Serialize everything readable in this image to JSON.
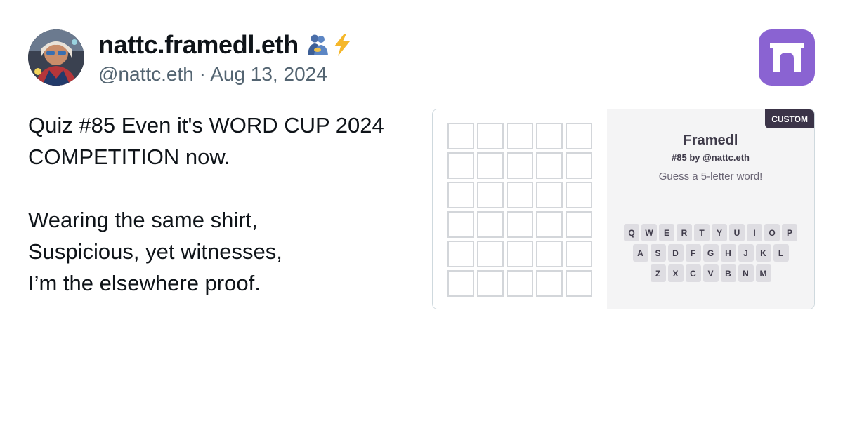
{
  "author": {
    "display_name": "nattc.framedl.eth",
    "emoji": [
      "people-hugging-icon",
      "high-voltage-icon"
    ],
    "handle": "@nattc.eth",
    "separator": "·",
    "date": "Aug 13, 2024"
  },
  "app_logo": {
    "icon": "farcaster-arch-icon",
    "color": "#8a63d2"
  },
  "post": {
    "lines": [
      "Quiz #85 Even it's WORD CUP 2024",
      "COMPETITION now.",
      "",
      "Wearing the same shirt,",
      "Suspicious, yet witnesses,",
      "I’m the elsewhere proof."
    ]
  },
  "frame": {
    "badge": "CUSTOM",
    "title": "Framedl",
    "subtitle": "#85 by @nattc.eth",
    "prompt": "Guess a 5-letter word!",
    "grid": {
      "rows": 6,
      "cols": 5
    },
    "keyboard": {
      "row1": [
        "Q",
        "W",
        "E",
        "R",
        "T",
        "Y",
        "U",
        "I",
        "O",
        "P"
      ],
      "row2": [
        "A",
        "S",
        "D",
        "F",
        "G",
        "H",
        "J",
        "K",
        "L"
      ],
      "row3": [
        "Z",
        "X",
        "C",
        "V",
        "B",
        "N",
        "M"
      ]
    }
  },
  "colors": {
    "accent": "#8a63d2",
    "badge_bg": "#3b3448",
    "muted_text": "#536471",
    "key_bg": "#dedde2",
    "info_bg": "#f4f4f5"
  }
}
